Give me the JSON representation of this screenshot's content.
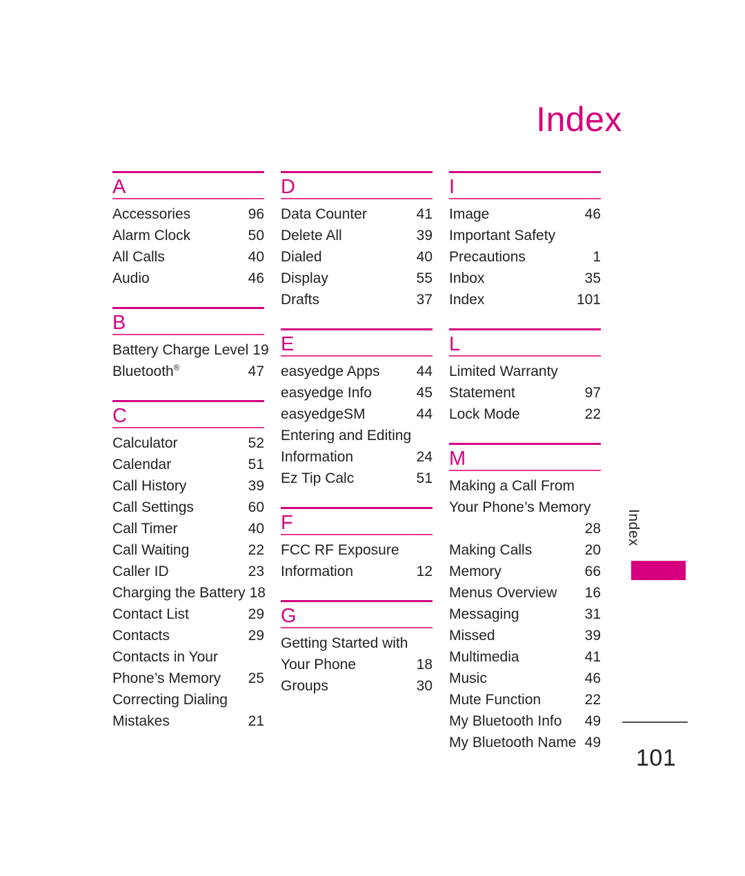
{
  "page": {
    "title": "Index",
    "folio": "101",
    "side_tab_label": "Index",
    "accent_color": "#d5007f",
    "rule_color": "#e6398c",
    "text_color": "#231f20"
  },
  "columns": [
    {
      "sections": [
        {
          "letter": "A",
          "entries": [
            {
              "label": "Accessories",
              "page": "96"
            },
            {
              "label": "Alarm Clock",
              "page": "50"
            },
            {
              "label": "All Calls",
              "page": "40"
            },
            {
              "label": "Audio",
              "page": "46"
            }
          ]
        },
        {
          "letter": "B",
          "entries": [
            {
              "label": "Battery Charge Level",
              "page": "19"
            },
            {
              "label": "Bluetooth",
              "mark": "®",
              "page": "47"
            }
          ]
        },
        {
          "letter": "C",
          "entries": [
            {
              "label": "Calculator",
              "page": "52"
            },
            {
              "label": "Calendar",
              "page": "51"
            },
            {
              "label": "Call History",
              "page": "39"
            },
            {
              "label": "Call Settings",
              "page": "60"
            },
            {
              "label": "Call Timer",
              "page": "40"
            },
            {
              "label": "Call Waiting",
              "page": "22"
            },
            {
              "label": "Caller ID",
              "page": "23"
            },
            {
              "label": "Charging the Battery",
              "page": "18"
            },
            {
              "label": "Contact List",
              "page": "29"
            },
            {
              "label": "Contacts",
              "page": "29"
            },
            {
              "lines": [
                "Contacts in Your",
                "Phone’s Memory"
              ],
              "page": "25"
            },
            {
              "lines": [
                "Correcting Dialing",
                "Mistakes"
              ],
              "page": "21"
            }
          ]
        }
      ]
    },
    {
      "sections": [
        {
          "letter": "D",
          "entries": [
            {
              "label": "Data Counter",
              "page": "41"
            },
            {
              "label": "Delete All",
              "page": "39"
            },
            {
              "label": "Dialed",
              "page": "40"
            },
            {
              "label": "Display",
              "page": "55"
            },
            {
              "label": "Drafts",
              "page": "37"
            }
          ]
        },
        {
          "letter": "E",
          "entries": [
            {
              "label": "easyedge Apps",
              "page": "44"
            },
            {
              "label": "easyedge Info",
              "page": "45"
            },
            {
              "label": "easyedgeSM",
              "page": "44"
            },
            {
              "lines": [
                "Entering and Editing",
                "Information"
              ],
              "page": "24"
            },
            {
              "label": "Ez Tip Calc",
              "page": "51"
            }
          ]
        },
        {
          "letter": "F",
          "entries": [
            {
              "lines": [
                "FCC RF Exposure",
                "Information"
              ],
              "page": "12"
            }
          ]
        },
        {
          "letter": "G",
          "entries": [
            {
              "lines": [
                "Getting Started with",
                "Your Phone"
              ],
              "page": "18"
            },
            {
              "label": "Groups",
              "page": "30"
            }
          ]
        }
      ]
    },
    {
      "sections": [
        {
          "letter": "I",
          "entries": [
            {
              "label": "Image",
              "page": "46"
            },
            {
              "lines": [
                "Important Safety",
                "Precautions"
              ],
              "page": "1"
            },
            {
              "label": "Inbox",
              "page": "35"
            },
            {
              "label": "Index",
              "page": "101"
            }
          ]
        },
        {
          "letter": "L",
          "entries": [
            {
              "lines": [
                "Limited Warranty",
                "Statement"
              ],
              "page": "97"
            },
            {
              "label": "Lock Mode",
              "page": "22"
            }
          ]
        },
        {
          "letter": "M",
          "entries": [
            {
              "lines": [
                "Making a Call From",
                "Your Phone’s Memory",
                ""
              ],
              "page": "28"
            },
            {
              "label": "Making Calls",
              "page": "20"
            },
            {
              "label": "Memory",
              "page": "66"
            },
            {
              "label": "Menus Overview",
              "page": "16"
            },
            {
              "label": "Messaging",
              "page": "31"
            },
            {
              "label": "Missed",
              "page": "39"
            },
            {
              "label": "Multimedia",
              "page": "41"
            },
            {
              "label": "Music",
              "page": "46"
            },
            {
              "label": "Mute Function",
              "page": "22"
            },
            {
              "label": "My Bluetooth Info",
              "page": "49"
            },
            {
              "label": "My Bluetooth Name",
              "page": "49"
            }
          ]
        }
      ]
    }
  ]
}
